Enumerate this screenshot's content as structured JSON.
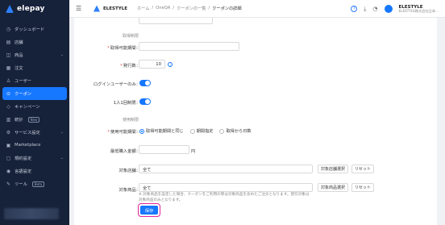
{
  "brand": {
    "logo_text": "elepay",
    "company": "ELESTYLE"
  },
  "sidebar": {
    "items": [
      {
        "label": "ダッシュボード",
        "icon": "dashboard-icon",
        "glyph": "◷"
      },
      {
        "label": "店舗",
        "icon": "store-icon",
        "glyph": "▤"
      },
      {
        "label": "商品",
        "icon": "product-icon",
        "glyph": "◫",
        "chevron": "⌄"
      },
      {
        "label": "注文",
        "icon": "order-icon",
        "glyph": "▦"
      },
      {
        "label": "ユーザー",
        "icon": "user-icon",
        "glyph": "♙"
      },
      {
        "label": "クーポン",
        "icon": "coupon-icon",
        "glyph": "⊙",
        "active": true
      },
      {
        "label": "キャンペーン",
        "icon": "campaign-icon",
        "glyph": "◇"
      },
      {
        "label": "統計",
        "icon": "stats-icon",
        "glyph": "▥",
        "badge": "New"
      },
      {
        "label": "サービス設定",
        "icon": "service-settings-icon",
        "glyph": "⚙",
        "chevron": "⌄"
      },
      {
        "label": "Marketplace",
        "icon": "marketplace-icon",
        "glyph": "▣"
      },
      {
        "label": "規約設定",
        "icon": "terms-icon",
        "glyph": "▢",
        "chevron": "⌄"
      },
      {
        "label": "言語設定",
        "icon": "language-icon",
        "glyph": "◉"
      },
      {
        "label": "ツール",
        "icon": "tool-icon",
        "glyph": "✎",
        "badge": "Beta"
      }
    ]
  },
  "header": {
    "breadcrumbs": [
      "ホーム",
      "/",
      "OneQA",
      "/",
      "クーポンの一覧",
      "/",
      "クーポンの詳細"
    ],
    "user_name": "ELESTYLE",
    "user_sub": "ELESTYLE株式会社日本..."
  },
  "form": {
    "section_acquire": "取得制限",
    "acquire_period_label": "取得可能期間：",
    "issue_count_label": "発行数：",
    "issue_count_value": "10",
    "login_only_label": "ログインユーザーのみ：",
    "one_per_person_label": "1人1回制限：",
    "section_usage": "使用制限",
    "usage_period_label": "使用可能期間：",
    "usage_options": [
      "取得可能期間と同じ",
      "期間指定",
      "取得から日数"
    ],
    "min_purchase_label": "最低購入金額：",
    "min_purchase_unit": "円",
    "target_store_label": "対象店舗：",
    "target_store_value": "全て",
    "target_store_select": "対象店舗選択",
    "reset_label": "リセット",
    "target_product_label": "対象商品：",
    "target_product_value": "全て",
    "target_product_select": "対象商品選択",
    "note": "※ 対象商品を設定した場合、クーポンをご利用の際は対象商品を含めたご注文となります。割引対象は対象商品のみとなります。",
    "save_label": "保存"
  },
  "colors": {
    "accent": "#1677ff",
    "sidebar_bg": "#16213a",
    "highlight": "#e0239b"
  }
}
